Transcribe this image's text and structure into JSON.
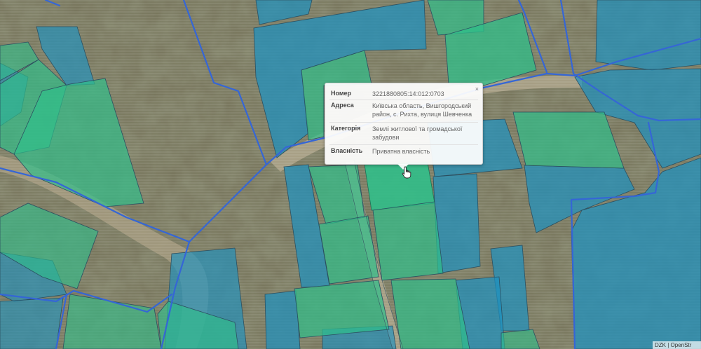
{
  "map": {
    "colors": {
      "residential_parcel": "#2fbf8a",
      "agricultural_parcel": "#1d92c0",
      "parcel_border": "#2b4f60",
      "cadastral_line": "#3566d6"
    },
    "attribution": "DZK | OpenStr"
  },
  "popup": {
    "close_icon": "×",
    "rows": [
      {
        "key": "Номер",
        "value": "3221880805:14:012:0703"
      },
      {
        "key": "Адреса",
        "value": "Київська область, Вишгородський район, с. Рихта, вулиця Шевченка"
      },
      {
        "key": "Категорія",
        "value": "Землі житлової та громадської забудови"
      },
      {
        "key": "Власність",
        "value": "Приватна власність"
      }
    ]
  }
}
